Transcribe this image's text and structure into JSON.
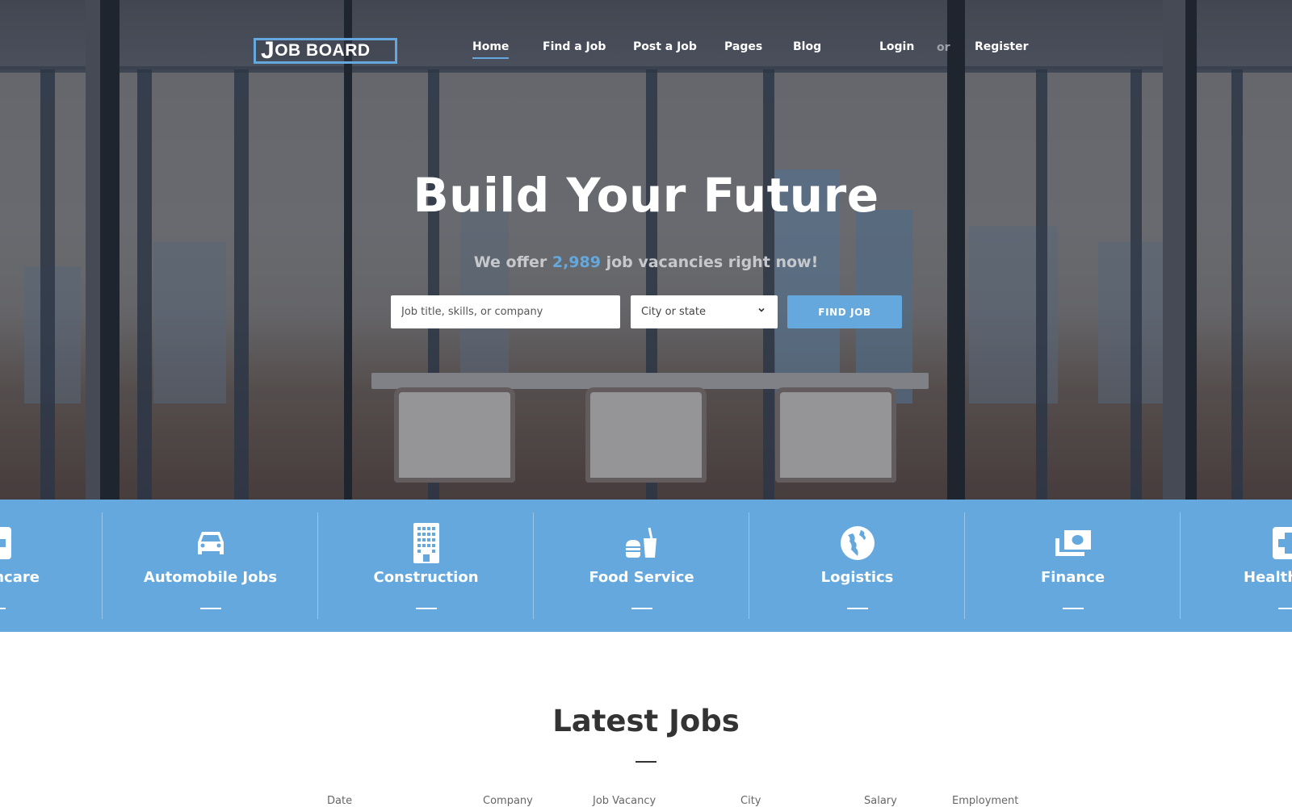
{
  "brand": {
    "logo_initial": "J",
    "logo_rest": "OB BOARD",
    "accent_color": "#64a8dd"
  },
  "nav": {
    "items": [
      {
        "label": "Home",
        "active": true
      },
      {
        "label": "Find a Job",
        "active": false
      },
      {
        "label": "Post a Job",
        "active": false
      },
      {
        "label": "Pages",
        "active": false
      },
      {
        "label": "Blog",
        "active": false
      }
    ],
    "login": "Login",
    "or": "or",
    "register": "Register"
  },
  "hero": {
    "title": "Build Your Future",
    "subtitle_before": "We offer ",
    "subtitle_count": "2,989",
    "subtitle_after": " job vacancies right now!",
    "search": {
      "placeholder": "Job title, skills, or company",
      "value": "",
      "city_selected": "City or state",
      "button_label": "FIND JOB"
    }
  },
  "categories": [
    {
      "label": "Healthcare",
      "icon": "medical-cross-icon",
      "partial": "left"
    },
    {
      "label": "Automobile Jobs",
      "icon": "car-icon"
    },
    {
      "label": "Construction",
      "icon": "building-icon"
    },
    {
      "label": "Food Service",
      "icon": "fast-food-icon"
    },
    {
      "label": "Logistics",
      "icon": "globe-icon"
    },
    {
      "label": "Finance",
      "icon": "money-icon"
    },
    {
      "label": "Healthcare",
      "icon": "medical-cross-icon",
      "partial": "right"
    }
  ],
  "latest_jobs": {
    "title": "Latest Jobs",
    "columns": [
      "Date",
      "Company",
      "Job Vacancy",
      "City",
      "Salary",
      "Employment"
    ]
  }
}
